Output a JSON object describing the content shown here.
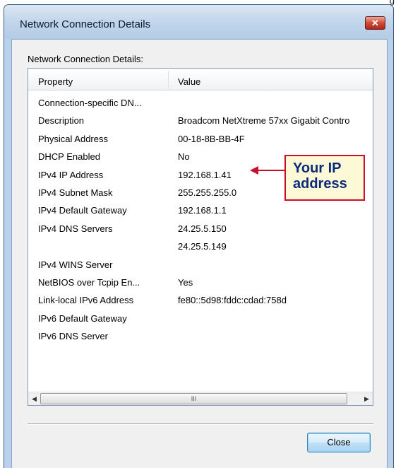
{
  "corner_text": "g",
  "window": {
    "title": "Network Connection Details",
    "close_icon": "close-icon"
  },
  "group_label": "Network Connection Details:",
  "list": {
    "headers": [
      "Property",
      "Value"
    ],
    "rows": [
      {
        "property": "Connection-specific DN...",
        "value": ""
      },
      {
        "property": "Description",
        "value": "Broadcom NetXtreme 57xx Gigabit Contro"
      },
      {
        "property": "Physical Address",
        "value": "00-18-8B-BB-4F"
      },
      {
        "property": "DHCP Enabled",
        "value": "No"
      },
      {
        "property": "IPv4 IP Address",
        "value": "192.168.1.41"
      },
      {
        "property": "IPv4 Subnet Mask",
        "value": "255.255.255.0"
      },
      {
        "property": "IPv4 Default Gateway",
        "value": "192.168.1.1"
      },
      {
        "property": "IPv4 DNS Servers",
        "value": "24.25.5.150"
      },
      {
        "property": "",
        "value": "24.25.5.149"
      },
      {
        "property": "IPv4 WINS Server",
        "value": ""
      },
      {
        "property": "NetBIOS over Tcpip En...",
        "value": "Yes"
      },
      {
        "property": "Link-local IPv6 Address",
        "value": "fe80::5d98:fddc:cdad:758d"
      },
      {
        "property": "IPv6 Default Gateway",
        "value": ""
      },
      {
        "property": "IPv6 DNS Server",
        "value": ""
      }
    ],
    "scroll_left": "◀",
    "scroll_right": "▶",
    "scroll_grip": "III"
  },
  "close_button": "Close",
  "callout": {
    "line1": "Your IP",
    "line2": "address",
    "border_color": "#c8102e",
    "text_color": "#0a2a7a"
  }
}
